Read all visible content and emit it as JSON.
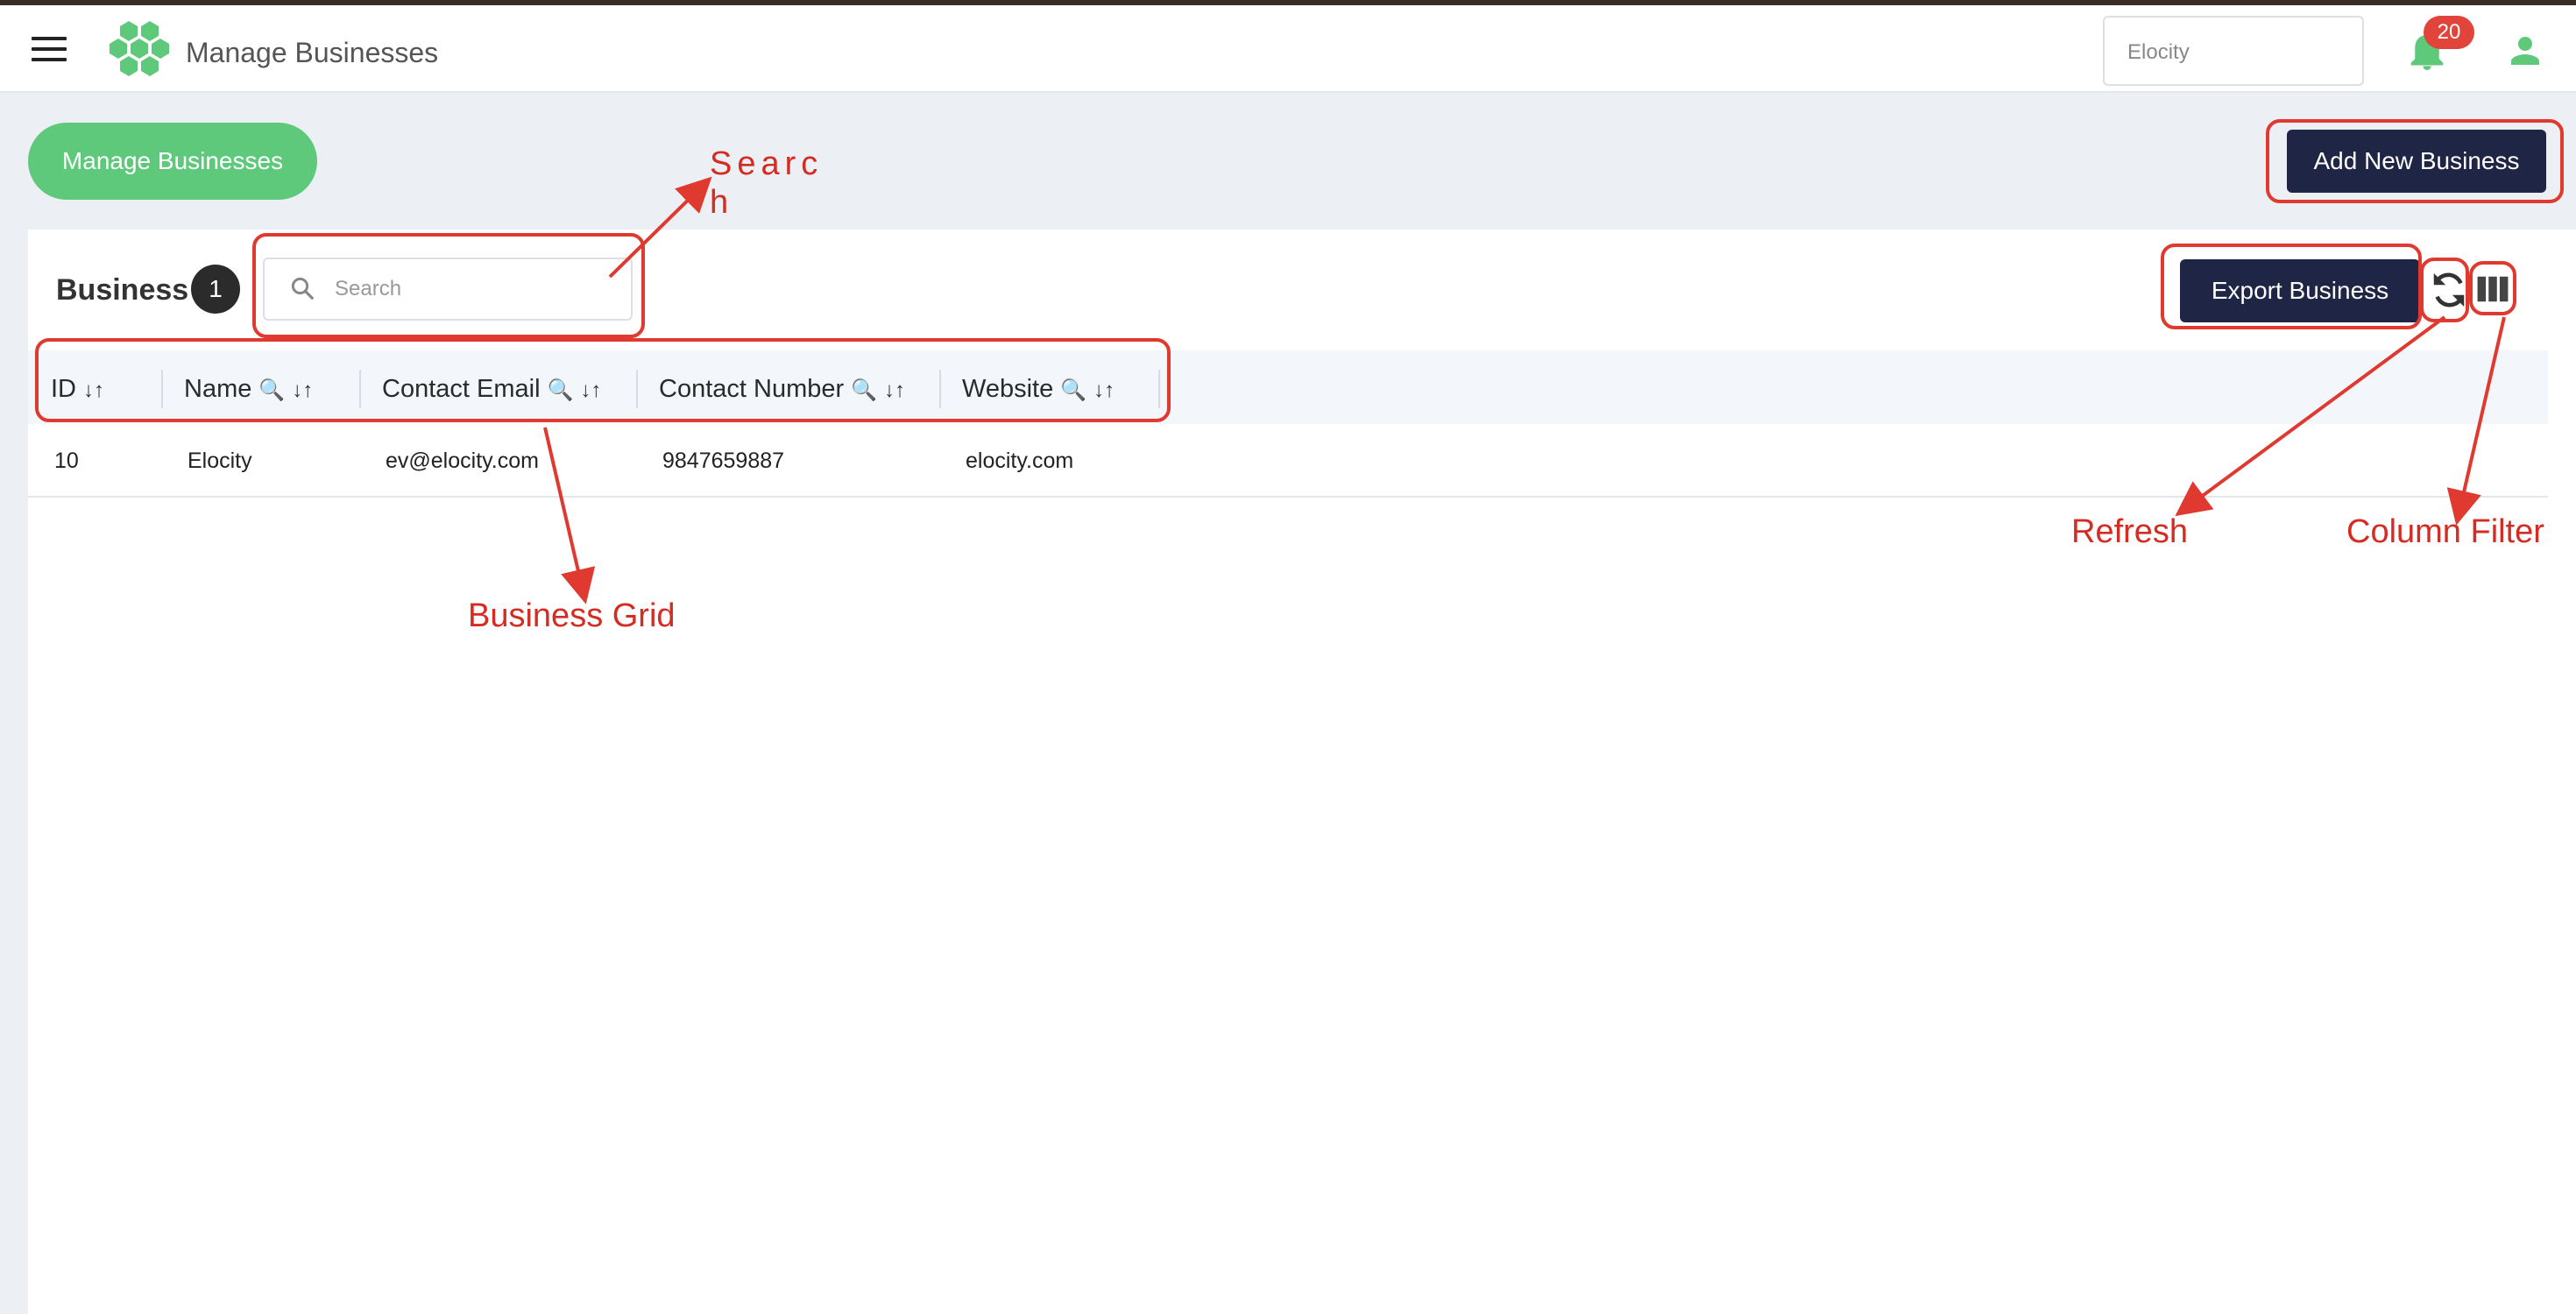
{
  "appbar": {
    "title": "Manage Businesses",
    "business_select": "Elocity",
    "notification_count": "20"
  },
  "tabs": {
    "manage_businesses": "Manage Businesses"
  },
  "actions": {
    "add_new_business": "Add New Business",
    "export_business": "Export Business"
  },
  "card": {
    "title": "Business",
    "count": "1",
    "search_placeholder": "Search"
  },
  "grid": {
    "columns": [
      {
        "label": "ID",
        "searchable": false
      },
      {
        "label": "Name",
        "searchable": true
      },
      {
        "label": "Contact Email",
        "searchable": true
      },
      {
        "label": "Contact Number",
        "searchable": true
      },
      {
        "label": "Website",
        "searchable": true
      }
    ],
    "rows": [
      {
        "id": "10",
        "name": "Elocity",
        "email": "ev@elocity.com",
        "number": "9847659887",
        "website": "elocity.com"
      }
    ]
  },
  "annotations": {
    "search_line1": "Searc",
    "search_line2": "h",
    "business_grid": "Business Grid",
    "refresh": "Refresh",
    "column_filter": "Column Filter"
  },
  "colors": {
    "brand_green": "#5fc97b",
    "dark_navy": "#1f2544",
    "annotation_red": "#e0392f",
    "badge_red": "#e0443a"
  },
  "icons": [
    "menu-icon",
    "hexagon-logo-icon",
    "bell-icon",
    "user-icon",
    "search-icon",
    "refresh-icon",
    "columns-icon",
    "sort-icon",
    "magnifier-icon"
  ]
}
